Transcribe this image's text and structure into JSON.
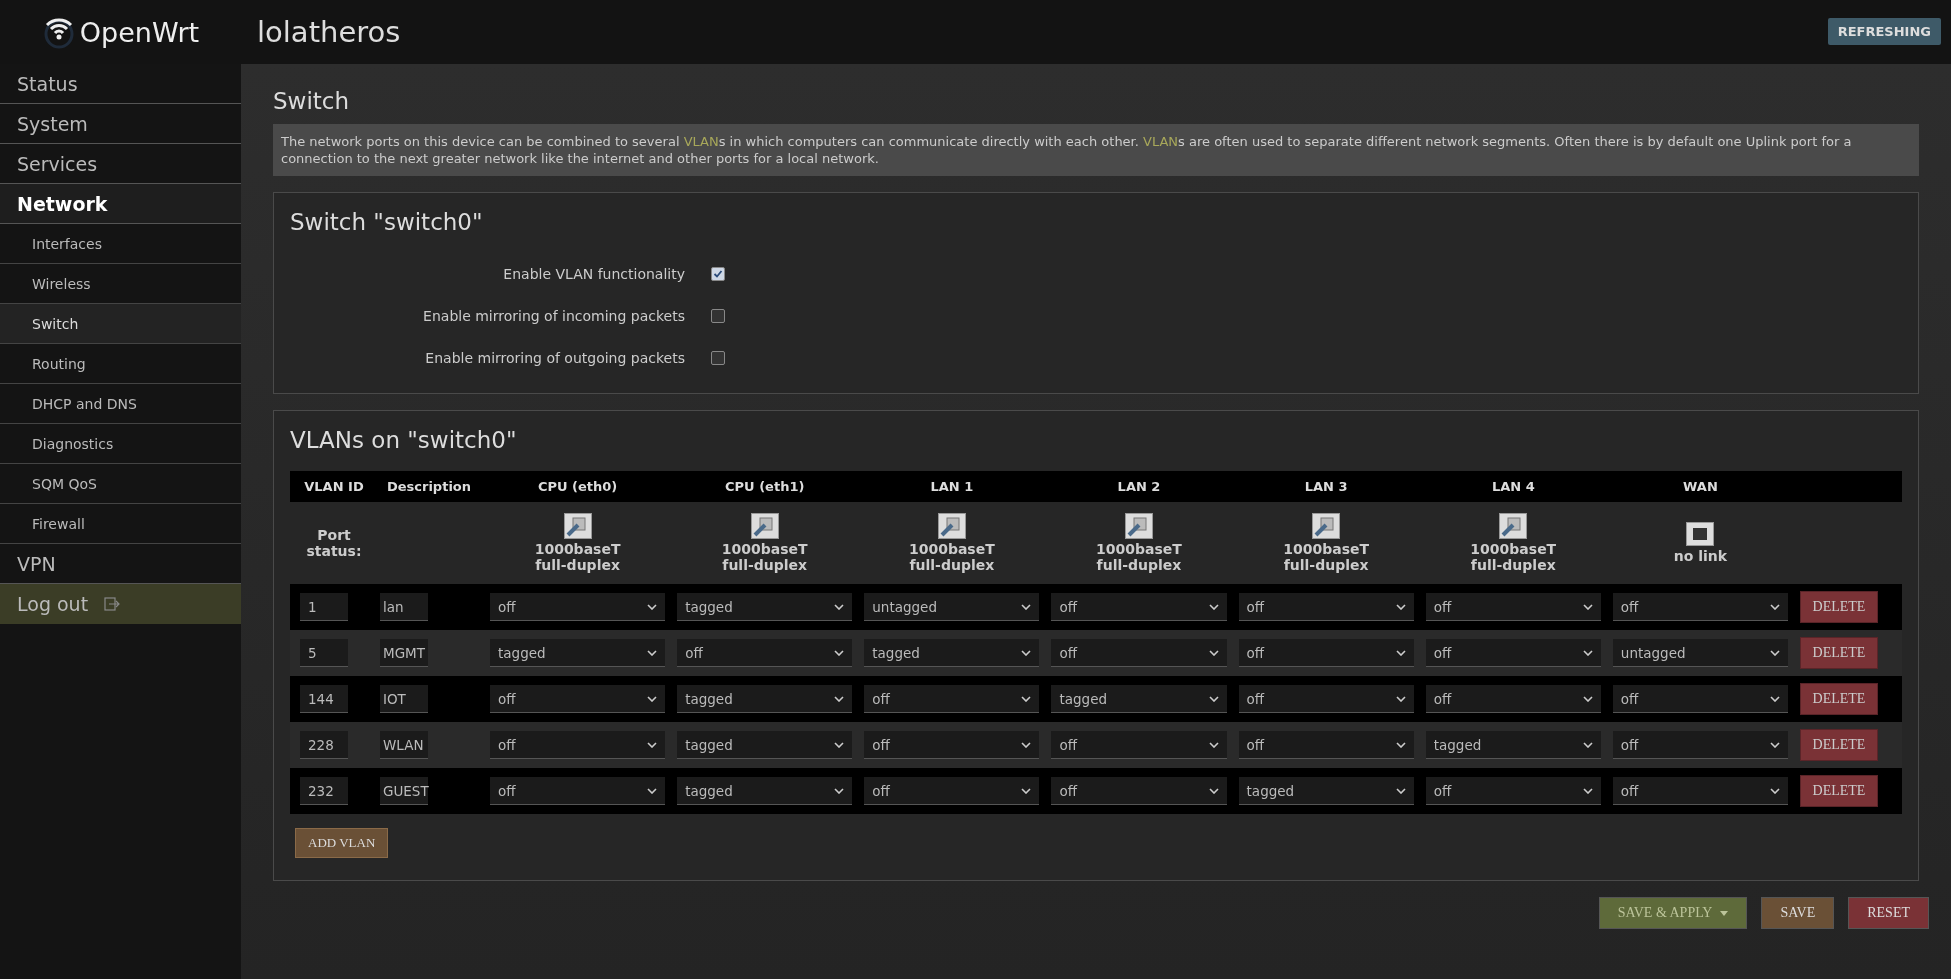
{
  "header": {
    "logo_text": "OpenWrt",
    "hostname": "lolatheros",
    "status_badge": "REFRESHING"
  },
  "sidebar": {
    "items": [
      {
        "label": "Status",
        "kind": "menu",
        "selected": false
      },
      {
        "label": "System",
        "kind": "menu",
        "selected": false
      },
      {
        "label": "Services",
        "kind": "menu",
        "selected": false
      },
      {
        "label": "Network",
        "kind": "menu",
        "selected": true,
        "children": [
          {
            "label": "Interfaces",
            "selected": false
          },
          {
            "label": "Wireless",
            "selected": false
          },
          {
            "label": "Switch",
            "selected": true
          },
          {
            "label": "Routing",
            "selected": false
          },
          {
            "label": "DHCP and DNS",
            "selected": false
          },
          {
            "label": "Diagnostics",
            "selected": false
          },
          {
            "label": "SQM QoS",
            "selected": false
          },
          {
            "label": "Firewall",
            "selected": false
          }
        ]
      },
      {
        "label": "VPN",
        "kind": "menu",
        "selected": false
      },
      {
        "label": "Log out",
        "kind": "logout",
        "selected": false
      }
    ]
  },
  "page": {
    "title": "Switch",
    "description": [
      {
        "kind": "text",
        "text": "The network ports on this device can be combined to several "
      },
      {
        "kind": "link",
        "text": "VLAN"
      },
      {
        "kind": "text",
        "text": "s in which computers can communicate directly with each other. "
      },
      {
        "kind": "link",
        "text": "VLAN"
      },
      {
        "kind": "text",
        "text": "s are often used to separate different network segments. Often there is by default one Uplink port for a connection to the next greater network like the internet and other ports for a local network."
      }
    ]
  },
  "switch_section": {
    "title": "Switch \"switch0\"",
    "options": [
      {
        "label": "Enable VLAN functionality",
        "checked": true
      },
      {
        "label": "Enable mirroring of incoming packets",
        "checked": false
      },
      {
        "label": "Enable mirroring of outgoing packets",
        "checked": false
      }
    ]
  },
  "vlan_section": {
    "title": "VLANs on \"switch0\"",
    "columns": [
      "VLAN ID",
      "Description",
      "CPU (eth0)",
      "CPU (eth1)",
      "LAN 1",
      "LAN 2",
      "LAN 3",
      "LAN 4",
      "WAN"
    ],
    "port_status_label": "Port status:",
    "port_status": [
      {
        "link": true,
        "speed": "1000baseT",
        "duplex": "full-duplex"
      },
      {
        "link": true,
        "speed": "1000baseT",
        "duplex": "full-duplex"
      },
      {
        "link": true,
        "speed": "1000baseT",
        "duplex": "full-duplex"
      },
      {
        "link": true,
        "speed": "1000baseT",
        "duplex": "full-duplex"
      },
      {
        "link": true,
        "speed": "1000baseT",
        "duplex": "full-duplex"
      },
      {
        "link": true,
        "speed": "1000baseT",
        "duplex": "full-duplex"
      },
      {
        "link": false,
        "speed": "no link"
      }
    ],
    "rows": [
      {
        "vlan_id": "1",
        "description": "lan",
        "ports": [
          "off",
          "tagged",
          "untagged",
          "off",
          "off",
          "off",
          "off"
        ],
        "delete": "DELETE"
      },
      {
        "vlan_id": "5",
        "description": "MGMT",
        "ports": [
          "tagged",
          "off",
          "tagged",
          "off",
          "off",
          "off",
          "untagged"
        ],
        "delete": "DELETE"
      },
      {
        "vlan_id": "144",
        "description": "IOT",
        "ports": [
          "off",
          "tagged",
          "off",
          "tagged",
          "off",
          "off",
          "off"
        ],
        "delete": "DELETE"
      },
      {
        "vlan_id": "228",
        "description": "WLAN",
        "ports": [
          "off",
          "tagged",
          "off",
          "off",
          "off",
          "tagged",
          "off"
        ],
        "delete": "DELETE"
      },
      {
        "vlan_id": "232",
        "description": "GUEST",
        "ports": [
          "off",
          "tagged",
          "off",
          "off",
          "tagged",
          "off",
          "off"
        ],
        "delete": "DELETE"
      }
    ],
    "add_button": "ADD VLAN"
  },
  "footer_buttons": [
    {
      "label": "SAVE & APPLY",
      "kind": "apply"
    },
    {
      "label": "SAVE",
      "kind": "save"
    },
    {
      "label": "RESET",
      "kind": "reset"
    }
  ]
}
